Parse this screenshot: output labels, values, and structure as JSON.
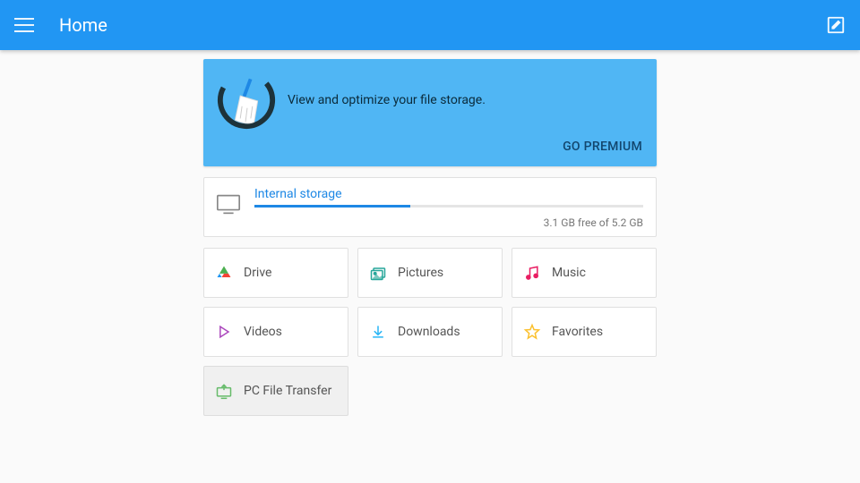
{
  "header": {
    "title": "Home"
  },
  "promo": {
    "text": "View and optimize your file storage.",
    "cta": "GO PREMIUM"
  },
  "storage": {
    "label": "Internal storage",
    "free_text": "3.1 GB free of 5.2 GB",
    "used_percent": 40
  },
  "tiles": [
    {
      "label": "Drive"
    },
    {
      "label": "Pictures"
    },
    {
      "label": "Music"
    },
    {
      "label": "Videos"
    },
    {
      "label": "Downloads"
    },
    {
      "label": "Favorites"
    },
    {
      "label": "PC File Transfer"
    }
  ]
}
